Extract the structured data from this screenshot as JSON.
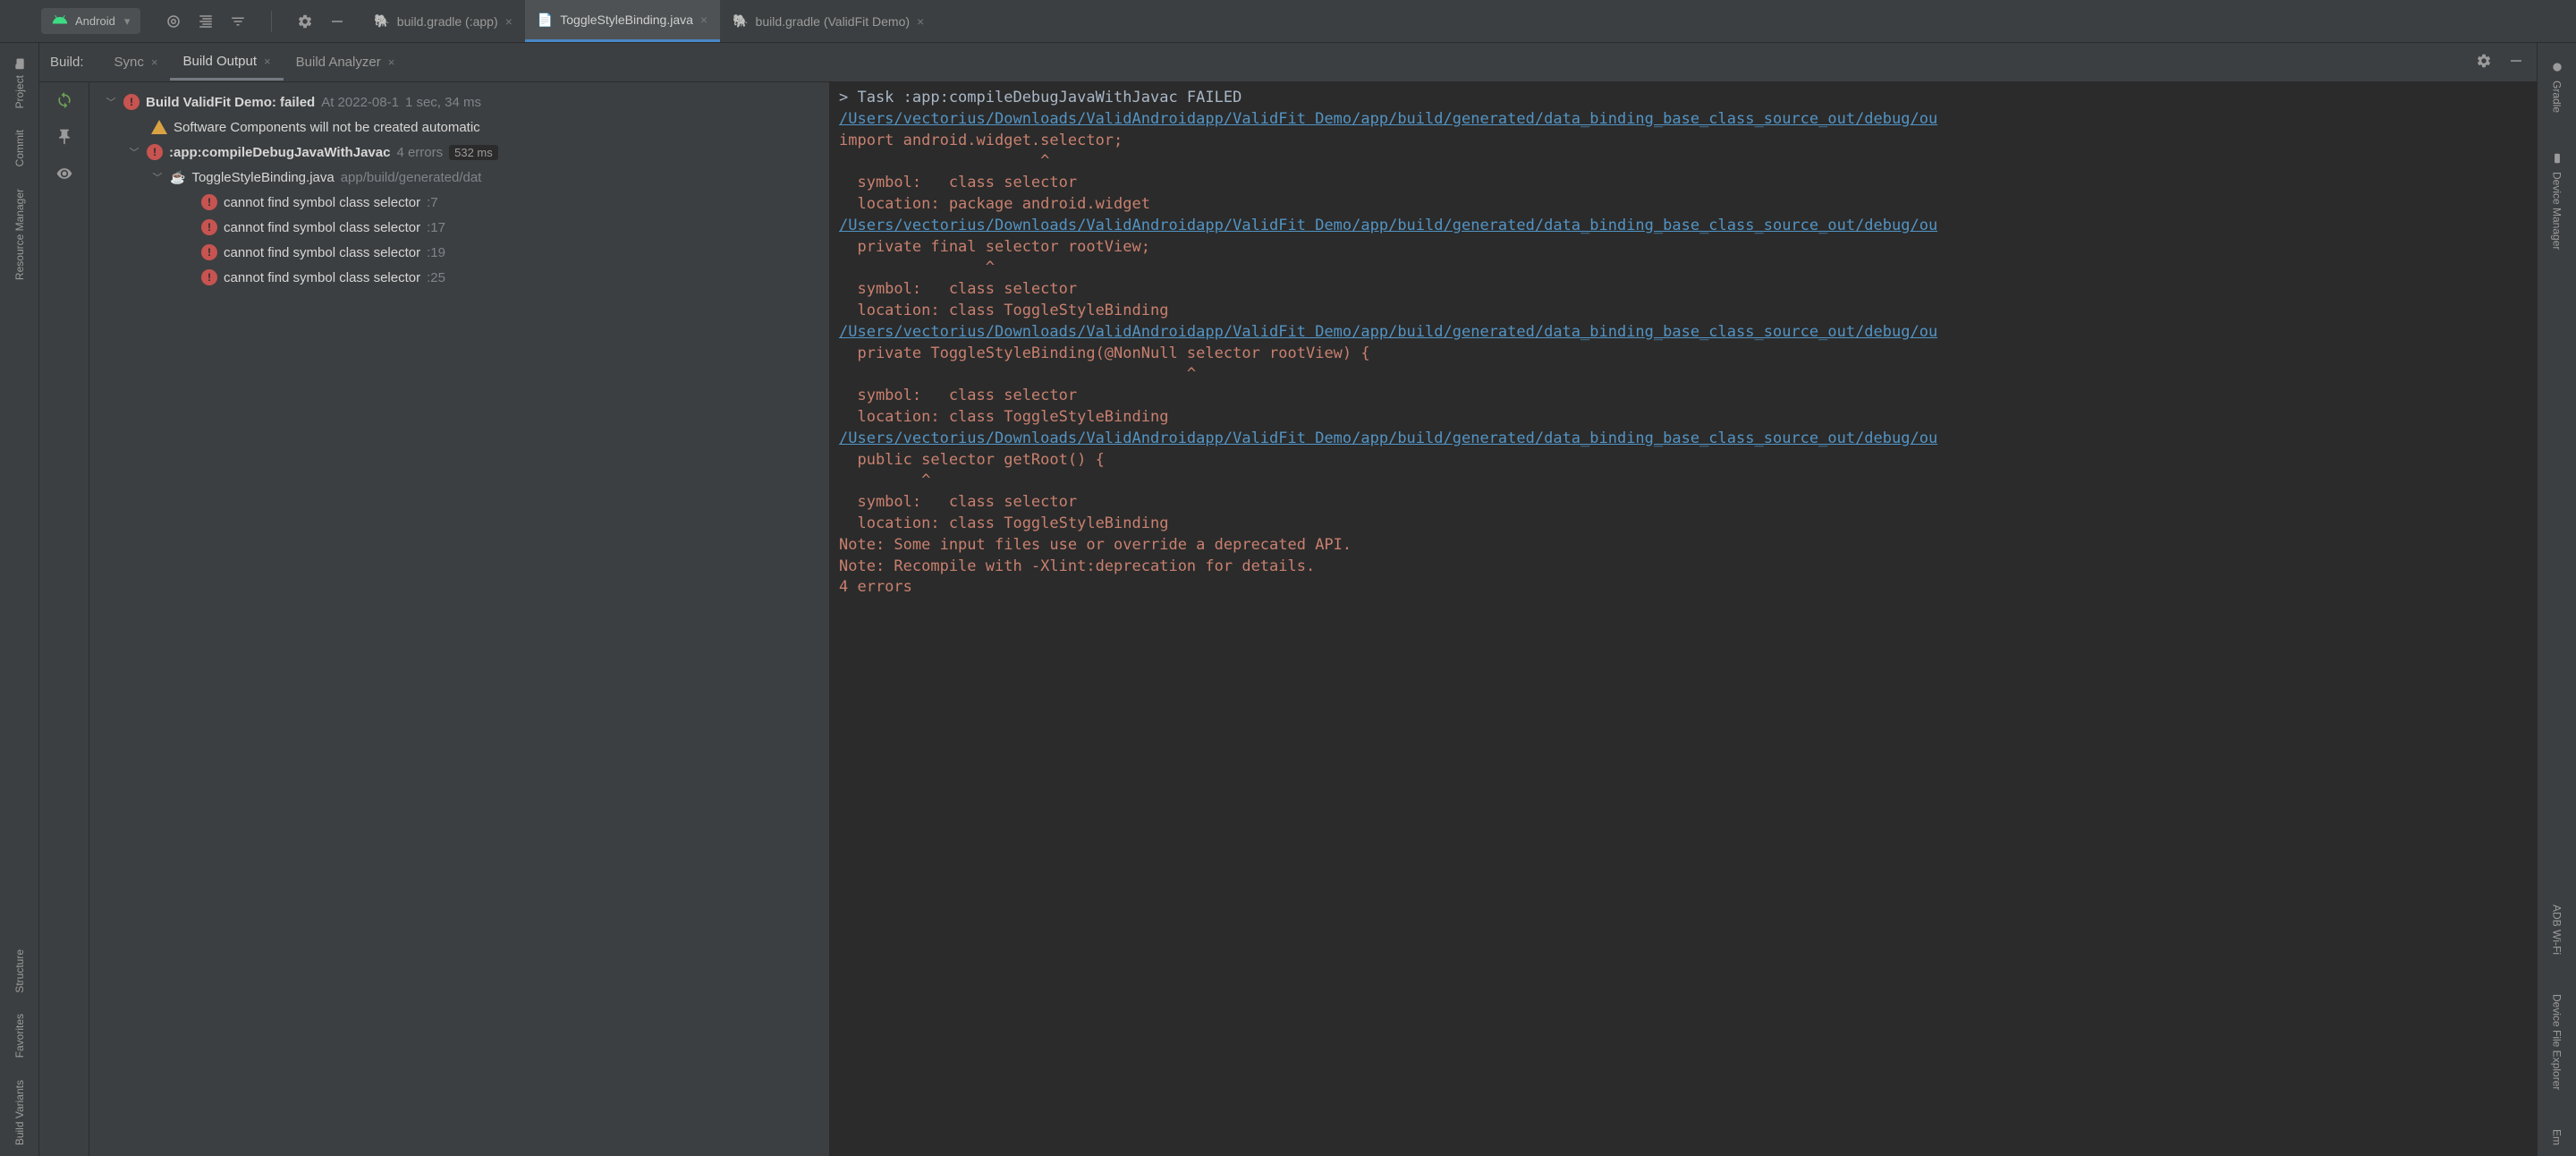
{
  "toolbar": {
    "config_label": "Android"
  },
  "editor_tabs": [
    {
      "label": "build.gradle (:app)",
      "active": false,
      "icon": "gradle"
    },
    {
      "label": "ToggleStyleBinding.java",
      "active": true,
      "icon": "java"
    },
    {
      "label": "build.gradle (ValidFit Demo)",
      "active": false,
      "icon": "gradle"
    }
  ],
  "build_header": {
    "label": "Build:",
    "tabs": [
      {
        "label": "Sync",
        "active": false
      },
      {
        "label": "Build Output",
        "active": true
      },
      {
        "label": "Build Analyzer",
        "active": false
      }
    ]
  },
  "tree": {
    "root": {
      "title_prefix": "Build ",
      "title_name": "ValidFit Demo:",
      "status": " failed",
      "meta": "At 2022-08-1",
      "duration": "1 sec, 34 ms"
    },
    "warn": "Software Components will not be created automatic",
    "compile": {
      "name": ":app:compileDebugJavaWithJavac",
      "errors": "4 errors",
      "time": "532 ms"
    },
    "file": {
      "name": "ToggleStyleBinding.java",
      "path": "app/build/generated/dat"
    },
    "errors": [
      {
        "msg": "cannot find symbol class selector",
        "line": ":7"
      },
      {
        "msg": "cannot find symbol class selector",
        "line": ":17"
      },
      {
        "msg": "cannot find symbol class selector",
        "line": ":19"
      },
      {
        "msg": "cannot find symbol class selector",
        "line": ":25"
      }
    ]
  },
  "console": {
    "task_line": "> Task :app:compileDebugJavaWithJavac FAILED",
    "path": "/Users/vectorius/Downloads/ValidAndroidapp/ValidFit Demo/app/build/generated/data_binding_base_class_source_out/debug/ou",
    "e1_code": "import android.widget.selector;",
    "e1_caret": "                      ^",
    "sym": "  symbol:   class selector",
    "loc_pkg": "  location: package android.widget",
    "e2_code": "  private final selector rootView;",
    "e2_caret": "                ^",
    "loc_cls": "  location: class ToggleStyleBinding",
    "e3_code": "  private ToggleStyleBinding(@NonNull selector rootView) {",
    "e3_caret": "                                      ^",
    "e4_code": "  public selector getRoot() {",
    "e4_caret": "         ^",
    "note1": "Note: Some input files use or override a deprecated API.",
    "note2": "Note: Recompile with -Xlint:deprecation for details.",
    "count": "4 errors"
  },
  "left_tabs": [
    "Project",
    "Commit",
    "Resource Manager",
    "Structure",
    "Favorites",
    "Build Variants"
  ],
  "right_tabs": [
    "Gradle",
    "Device Manager",
    "ADB Wi-Fi",
    "Device File Explorer",
    "Em"
  ]
}
